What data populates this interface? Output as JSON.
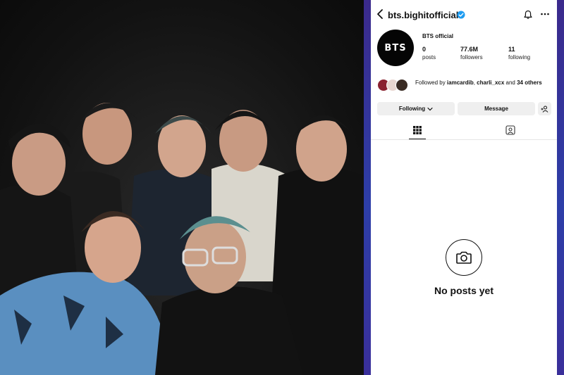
{
  "profile": {
    "username": "bts.bighitofficial",
    "avatar_text": "BTS",
    "display_name": "BTS official",
    "stats": [
      {
        "value": "0",
        "label": "posts"
      },
      {
        "value": "77.6M",
        "label": "followers"
      },
      {
        "value": "11",
        "label": "following"
      }
    ],
    "followed_by": {
      "prefix": "Followed by ",
      "name1": "iamcardib",
      "sep": ", ",
      "name2": "charli_xcx",
      "and": " and ",
      "others": "34 others"
    }
  },
  "actions": {
    "following_label": "Following",
    "message_label": "Message"
  },
  "empty_state": {
    "text": "No posts yet"
  },
  "colors": {
    "verified": "#1d9bf0",
    "button_bg": "#efefef",
    "frame_left": "#3b2a8c",
    "frame_right": "#2d3ea8"
  },
  "icons": [
    "back-arrow-icon",
    "verified-badge-icon",
    "bell-icon",
    "more-options-icon",
    "chevron-down-icon",
    "add-user-icon",
    "grid-icon",
    "tagged-icon",
    "camera-icon"
  ]
}
